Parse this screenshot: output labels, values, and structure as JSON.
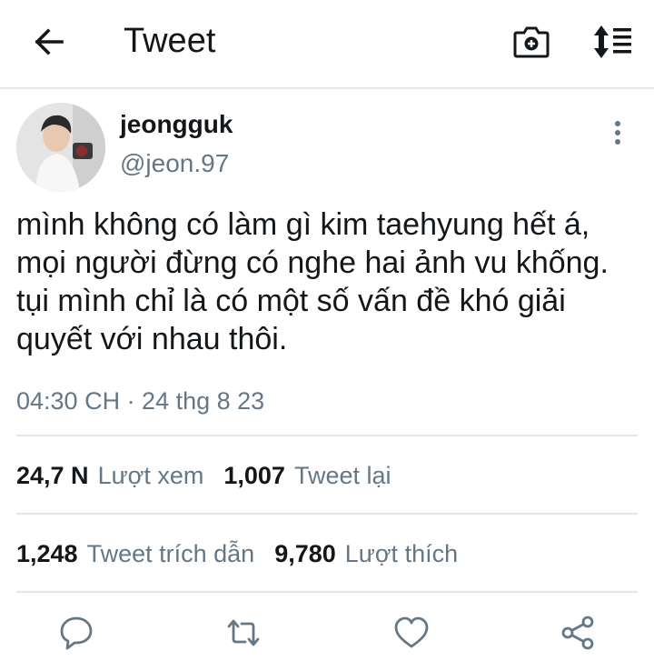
{
  "header": {
    "title": "Tweet",
    "back_icon": "arrow-left-icon",
    "camera_icon": "camera-icon",
    "sort_icon": "sort-icon"
  },
  "tweet": {
    "author_name": "jeongguk",
    "author_handle": "@jeon.97",
    "text": "mình không có làm gì kim taehyung hết á, mọi người đừng có nghe hai ảnh vu khống. tụi mình chỉ là có một số vấn đề khó giải quyết với nhau thôi.",
    "timestamp": "04:30 CH · 24 thg 8 23"
  },
  "stats": {
    "views_count": "24,7 N",
    "views_label": "Lượt xem",
    "retweets_count": "1,007",
    "retweets_label": "Tweet lại",
    "quotes_count": "1,248",
    "quotes_label": "Tweet trích dẫn",
    "likes_count": "9,780",
    "likes_label": "Lượt thích"
  },
  "colors": {
    "text": "#14171a",
    "secondary": "#657786",
    "divider": "#e6e6e6",
    "icon": "#657786"
  }
}
